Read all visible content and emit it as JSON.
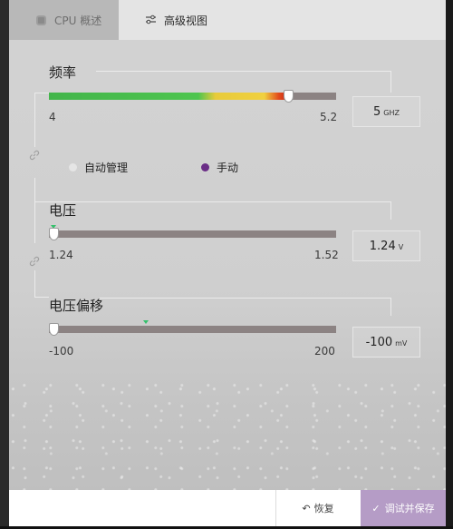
{
  "tabs": {
    "cpu_overview": "CPU 概述",
    "advanced_view": "高级视图"
  },
  "frequency": {
    "title": "频率",
    "min": "4",
    "max": "5.2",
    "value": "5",
    "unit": "GHZ",
    "slider_fraction": 0.833
  },
  "mode": {
    "auto_label": "自动管理",
    "manual_label": "手动",
    "selected": "manual"
  },
  "voltage": {
    "title": "电压",
    "min": "1.24",
    "max": "1.52",
    "value": "1.24",
    "unit": "V",
    "slider_fraction": 0.0
  },
  "voltage_offset": {
    "title": "电压偏移",
    "min": "-100",
    "max": "200",
    "value": "-100",
    "unit": "mV",
    "slider_fraction": 0.0
  },
  "footer": {
    "restore_label": "恢复",
    "apply_label": "调试并保存"
  },
  "colors": {
    "accent_purple": "#6a2d86",
    "apply_button": "#b59cc6",
    "track": "#8c8383",
    "marker_green": "#34c06b"
  }
}
